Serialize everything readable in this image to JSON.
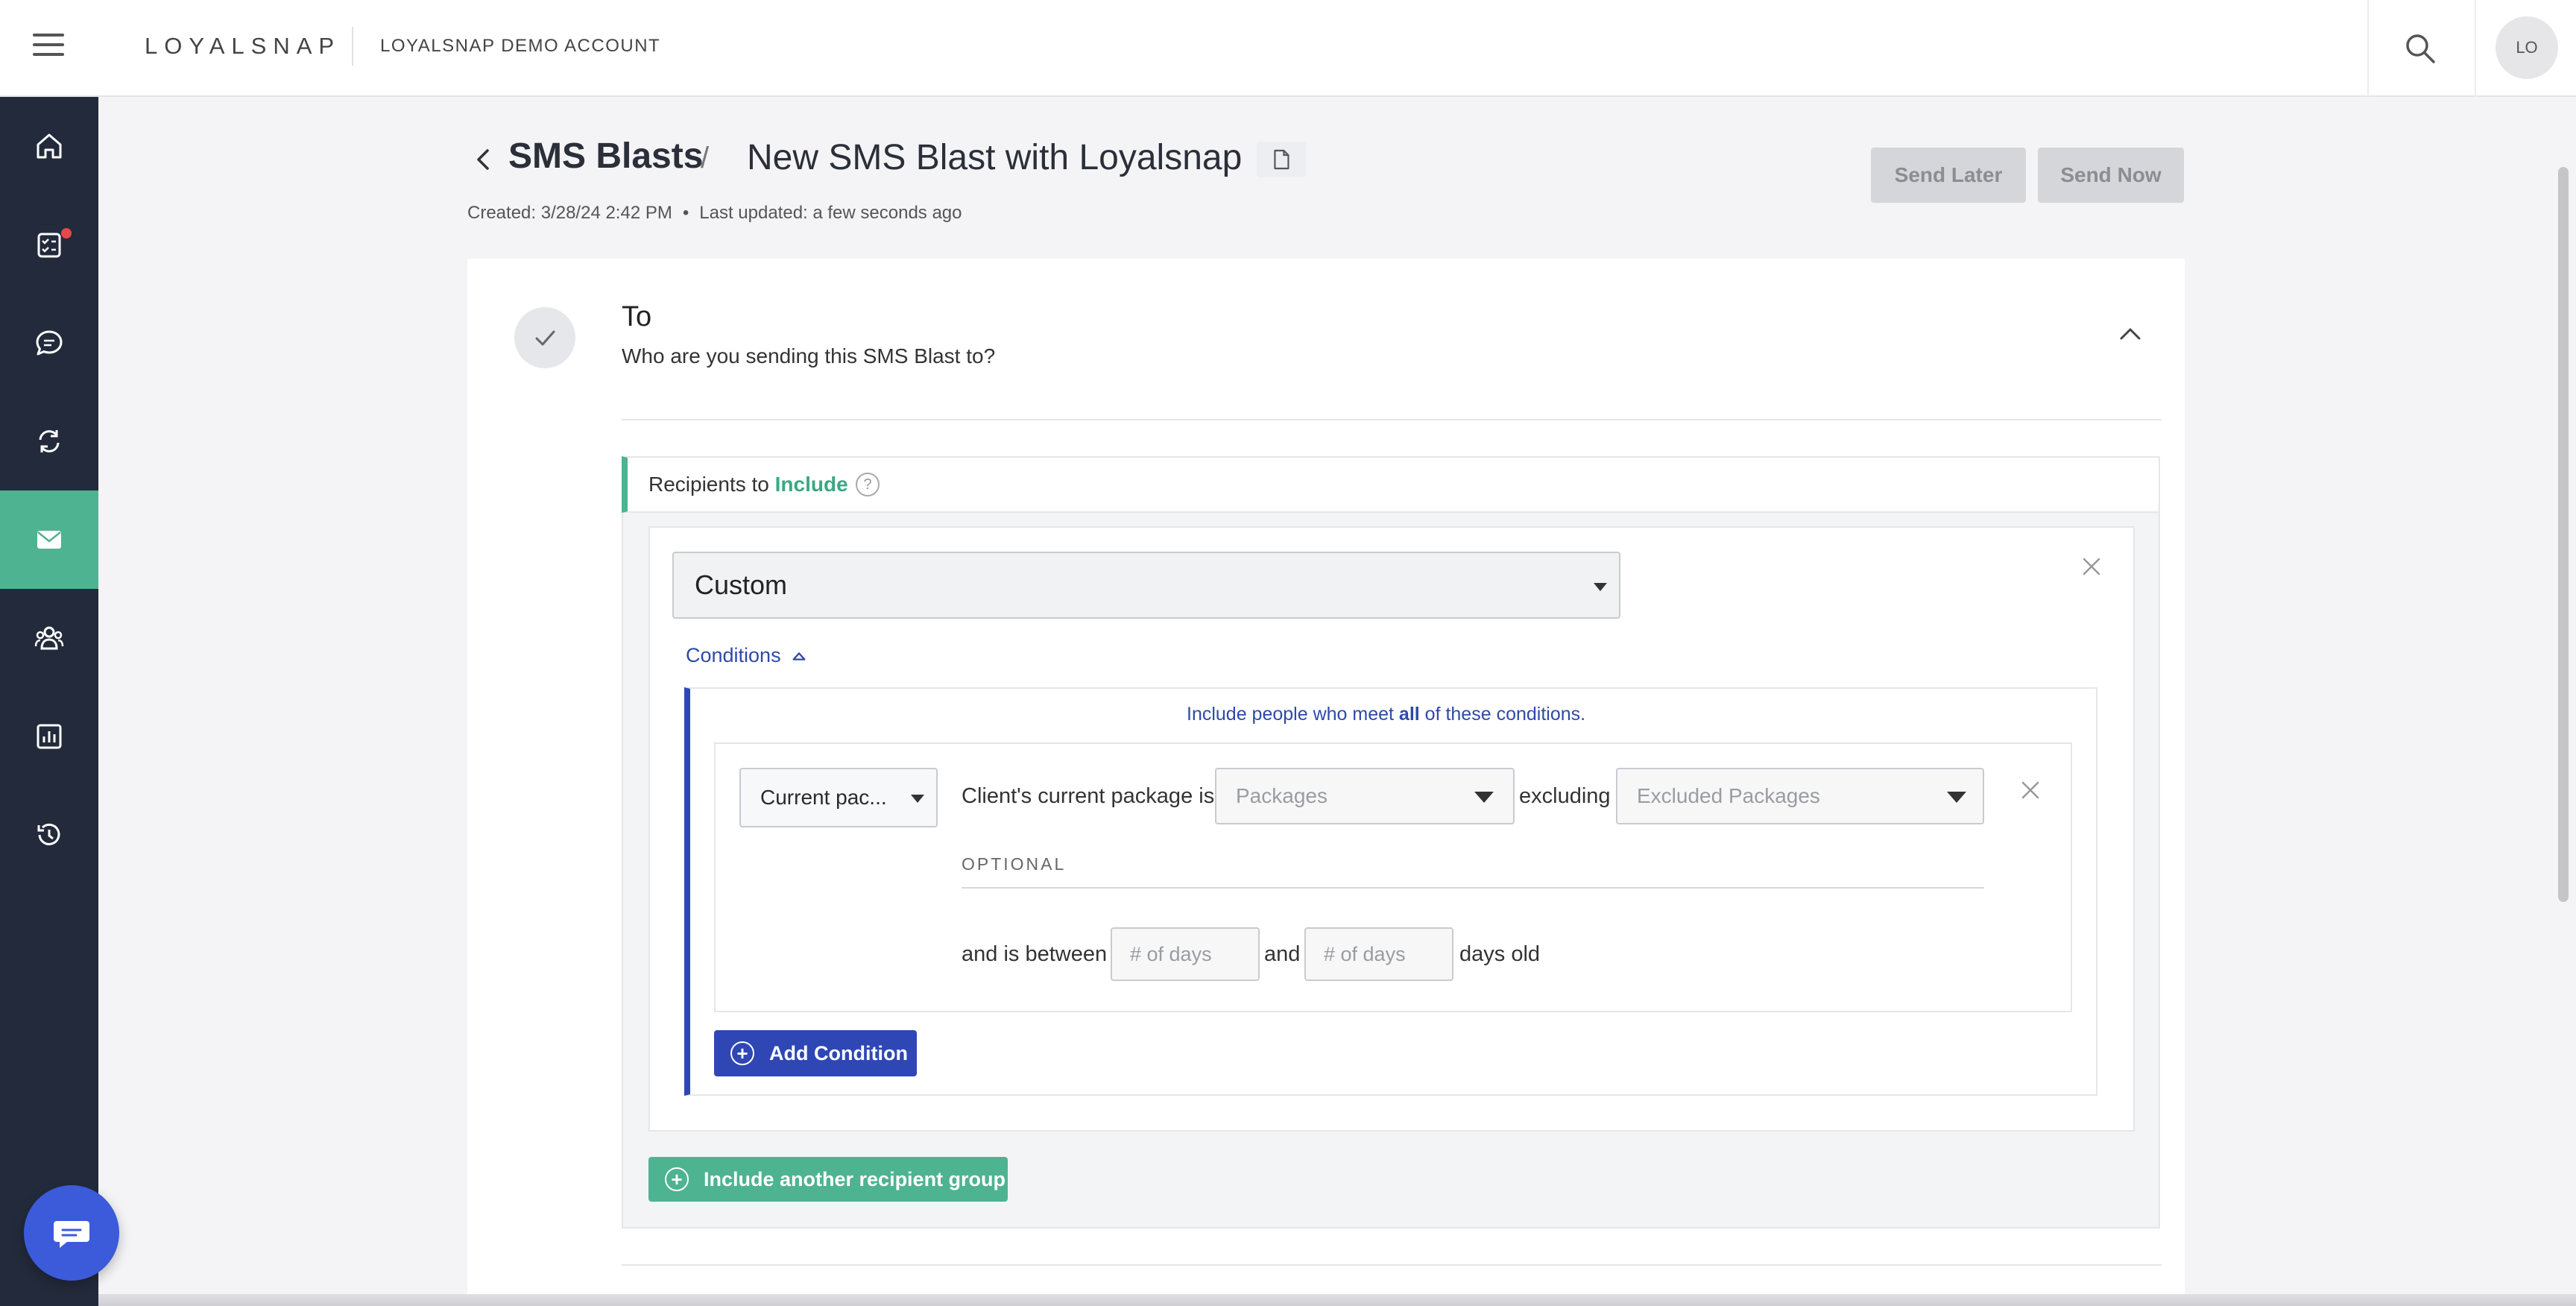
{
  "topbar": {
    "logo": "LOYALSNAP",
    "account_name": "LOYALSNAP DEMO ACCOUNT",
    "avatar_initials": "LO"
  },
  "sidebar": {
    "items": [
      {
        "name": "home",
        "icon": "home-icon"
      },
      {
        "name": "tasks",
        "icon": "checklist-icon",
        "notification": true
      },
      {
        "name": "messages",
        "icon": "chat-icon"
      },
      {
        "name": "automations",
        "icon": "refresh-icon"
      },
      {
        "name": "sms-blasts",
        "icon": "mail-icon",
        "active": true
      },
      {
        "name": "clients",
        "icon": "people-icon"
      },
      {
        "name": "reports",
        "icon": "bar-chart-icon"
      },
      {
        "name": "history",
        "icon": "history-icon"
      }
    ]
  },
  "header": {
    "breadcrumb": "SMS Blasts",
    "separator": "/",
    "title": "New SMS Blast with Loyalsnap",
    "created": "Created: 3/28/24 2:42 PM",
    "meta_dot": "•",
    "updated": "Last updated: a few seconds ago",
    "send_later": "Send Later",
    "send_now": "Send Now"
  },
  "to_section": {
    "title": "To",
    "subtitle": "Who are you sending this SMS Blast to?",
    "recipients_prefix": "Recipients to ",
    "recipients_emphasis": "Include",
    "help": "?",
    "audience_select": "Custom",
    "conditions_label": "Conditions",
    "conditions_note_prefix": "Include people who meet ",
    "conditions_note_bold": "all",
    "conditions_note_suffix": " of these conditions.",
    "condition": {
      "type_select": "Current pac...",
      "text_is": "Client's current package is",
      "packages_placeholder": "Packages",
      "text_excluding": "excluding",
      "excluded_placeholder": "Excluded Packages",
      "optional_label": "OPTIONAL",
      "text_between": "and is between",
      "days_min_placeholder": "# of days",
      "text_and": "and",
      "days_max_placeholder": "# of days",
      "text_days_old": "days old"
    },
    "add_condition": "Add Condition",
    "include_group": "Include another recipient group"
  },
  "colors": {
    "sidebar_bg": "#232a3b",
    "accent_green": "#4db391",
    "accent_blue": "#2e47b4",
    "notification_red": "#e5484d"
  }
}
